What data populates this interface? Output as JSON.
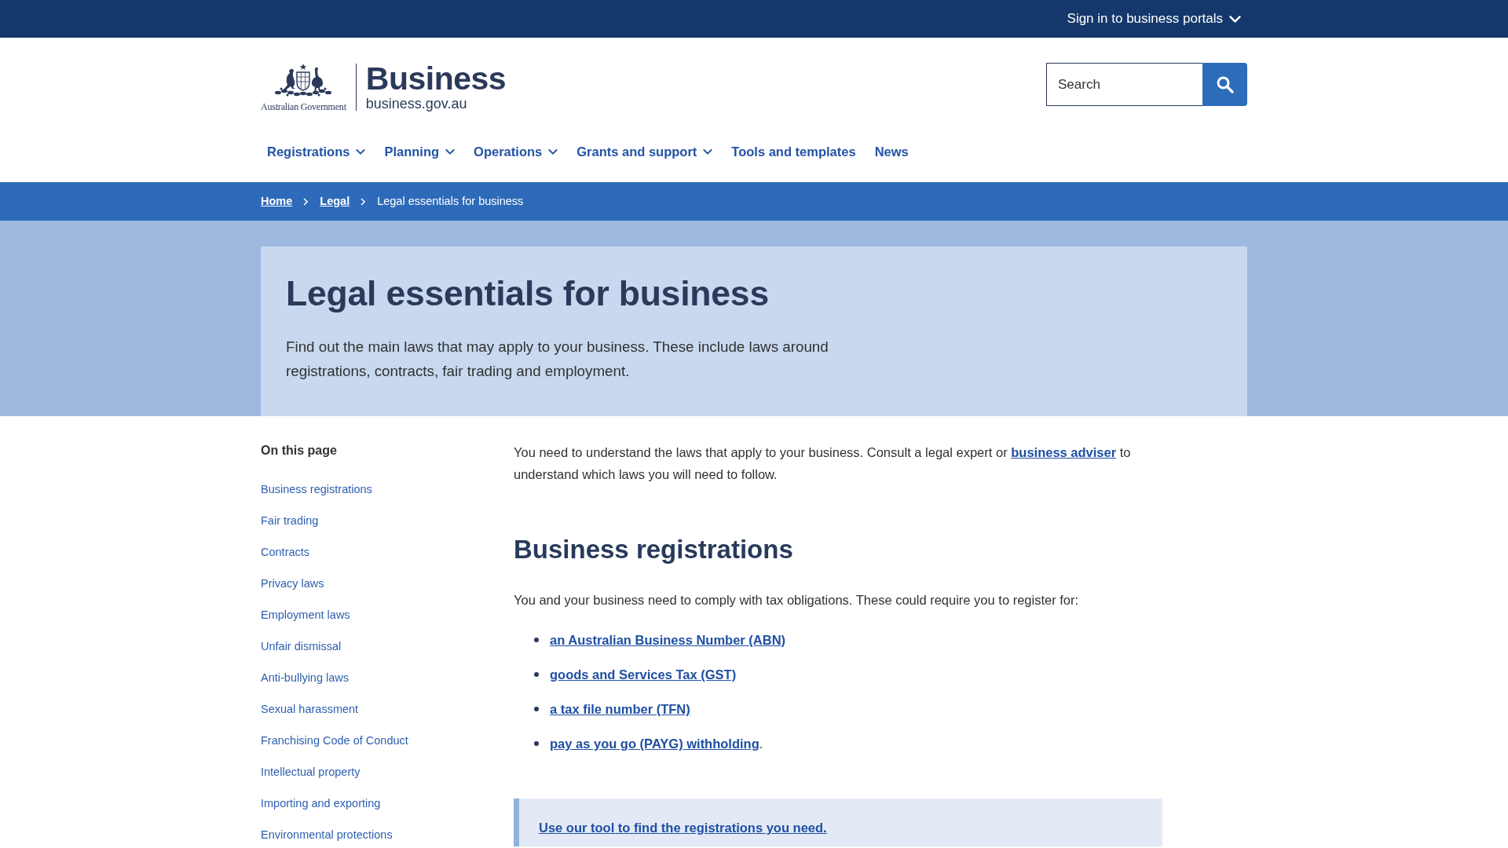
{
  "top_bar": {
    "portals_menu": "Sign in to business portals"
  },
  "header": {
    "logo": {
      "agency": "Australian Government",
      "title": "Business",
      "domain": "business.gov.au"
    },
    "search": {
      "placeholder": "Search"
    }
  },
  "nav": [
    {
      "label": "Registrations",
      "has_menu": true
    },
    {
      "label": "Planning",
      "has_menu": true
    },
    {
      "label": "Operations",
      "has_menu": true
    },
    {
      "label": "Grants and support",
      "has_menu": true
    },
    {
      "label": "Tools and templates",
      "has_menu": false
    },
    {
      "label": "News",
      "has_menu": false
    }
  ],
  "breadcrumb": [
    {
      "label": "Home",
      "kind": "link"
    },
    {
      "label": "Legal",
      "kind": "link"
    },
    {
      "label": "Legal essentials for business",
      "kind": "current"
    }
  ],
  "hero": {
    "title": "Legal essentials for business",
    "intro": "Find out the main laws that may apply to your business. These include laws around registrations, contracts, fair trading and employment."
  },
  "on_this_page": {
    "heading": "On this page",
    "items": [
      "Business registrations",
      "Fair trading",
      "Contracts",
      "Privacy laws",
      "Employment laws",
      "Unfair dismissal",
      "Anti-bullying laws",
      "Sexual harassment",
      "Franchising Code of Conduct",
      "Intellectual property",
      "Importing and exporting",
      "Environmental protections"
    ]
  },
  "content": {
    "intro": [
      {
        "kind": "text",
        "text": "You need to understand the laws that apply to your business. Consult a legal expert or "
      },
      {
        "kind": "link",
        "text": "business adviser"
      },
      {
        "kind": "text",
        "text": " to understand which laws you will need to follow."
      }
    ],
    "section": {
      "heading": "Business registrations",
      "text": "You and your business need to comply with tax obligations. These could require you to register for:",
      "links": [
        {
          "label": "an Australian Business Number (ABN)"
        },
        {
          "label": "goods and Services Tax (GST)"
        },
        {
          "label": "a tax file number (TFN)"
        },
        {
          "label": "pay as you go (PAYG) withholding",
          "after": "."
        }
      ]
    },
    "callout": {
      "link": "Use our tool to find the registrations you need."
    }
  }
}
